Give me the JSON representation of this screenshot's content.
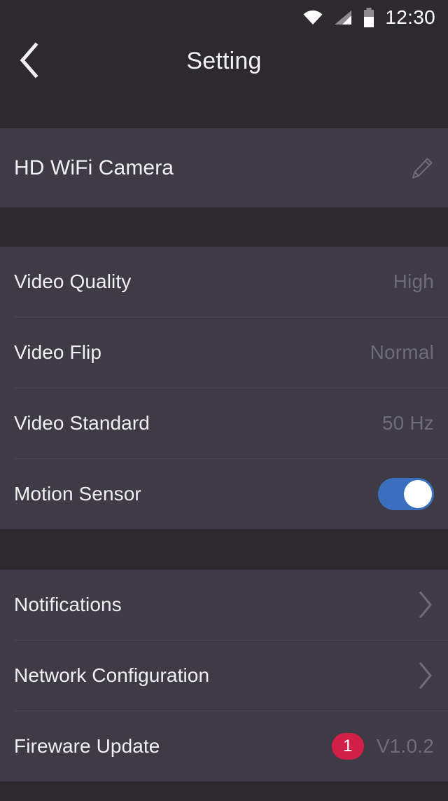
{
  "statusbar": {
    "wifi_icon": "wifi-icon",
    "signal_icon": "cellular-signal-icon",
    "battery_icon": "battery-icon",
    "time": "12:30"
  },
  "header": {
    "title": "Setting",
    "back_icon": "chevron-left-icon"
  },
  "device": {
    "name": "HD WiFi Camera",
    "edit_icon": "pencil-icon"
  },
  "video_section": [
    {
      "label": "Video Quality",
      "value": "High",
      "type": "value"
    },
    {
      "label": "Video Flip",
      "value": "Normal",
      "type": "value"
    },
    {
      "label": "Video Standard",
      "value": "50 Hz",
      "type": "value"
    },
    {
      "label": "Motion Sensor",
      "value": "on",
      "type": "toggle"
    }
  ],
  "system_section": [
    {
      "label": "Notifications",
      "type": "chevron"
    },
    {
      "label": "Network Configuration",
      "type": "chevron"
    },
    {
      "label": "Fireware Update",
      "type": "badge-value",
      "badge": "1",
      "value": "V1.0.2"
    }
  ],
  "colors": {
    "page_background": "#2c292f",
    "card_background": "#3e3b46",
    "divider": "#4a4753",
    "primary_text": "#f0eff3",
    "secondary_text": "#6f6c79",
    "toggle_on": "#3a6fc0",
    "badge": "#d11f48"
  }
}
